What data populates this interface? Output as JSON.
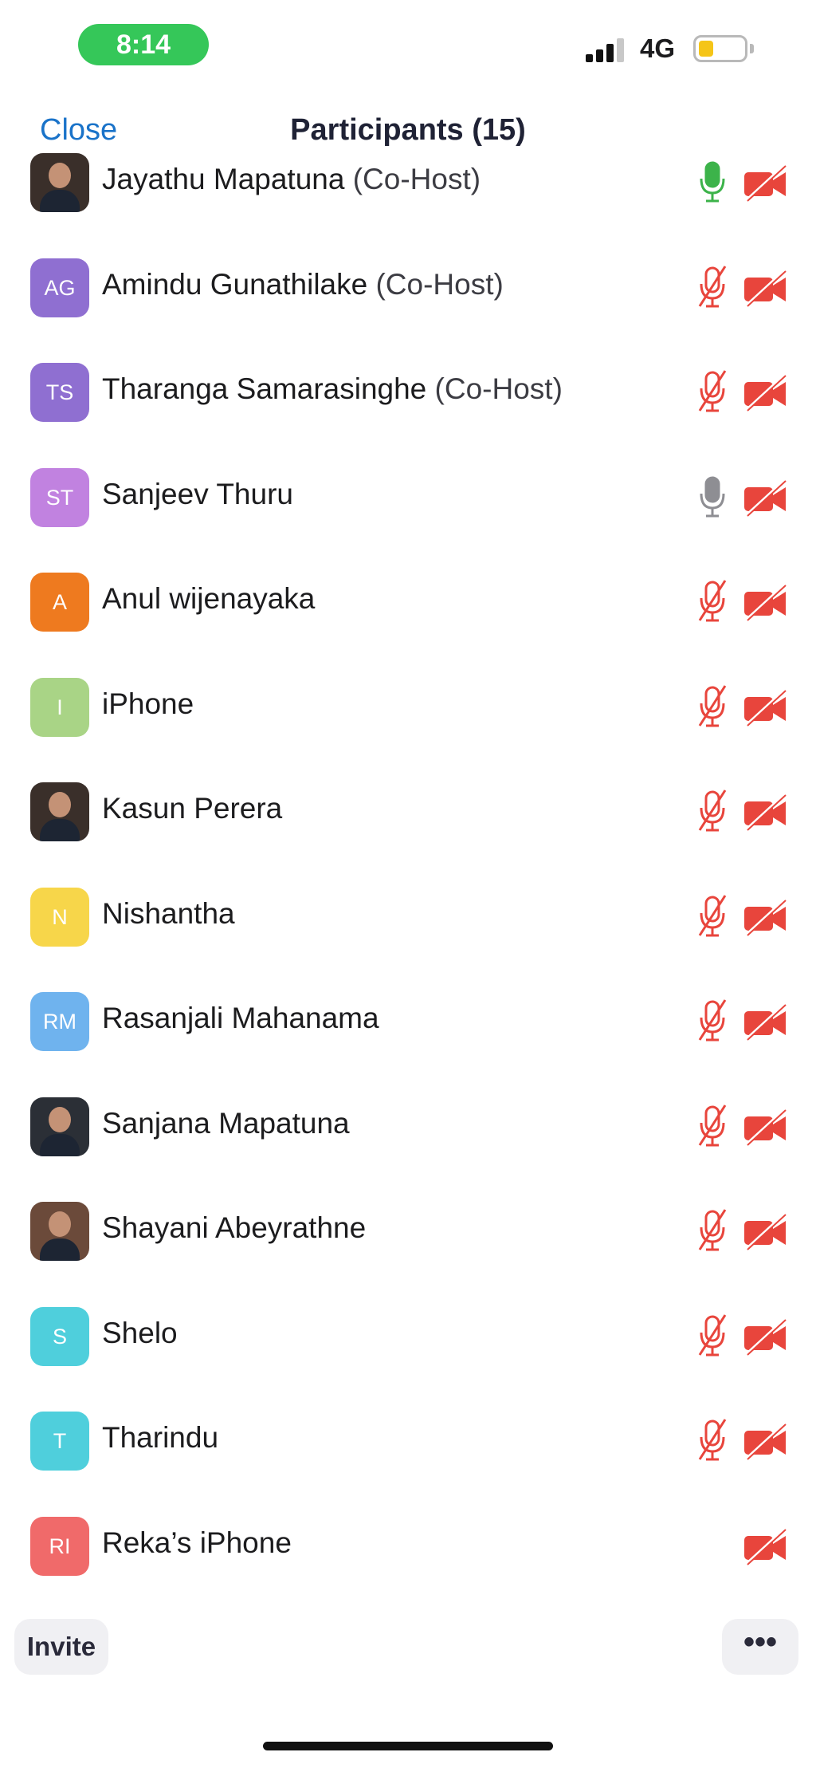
{
  "status_bar": {
    "time": "8:14",
    "network": "4G"
  },
  "nav": {
    "close_label": "Close",
    "title": "Participants (15)"
  },
  "participants": [
    {
      "name": "Jayathu Mapatuna",
      "role": "(Co-Host)",
      "avatar_type": "photo",
      "initials": "",
      "avatar_color": "#3a2f2a",
      "mic": "on"
    },
    {
      "name": "Amindu Gunathilake",
      "role": "(Co-Host)",
      "avatar_type": "initials",
      "initials": "AG",
      "avatar_color": "#8f6fd1",
      "mic": "muted"
    },
    {
      "name": "Tharanga Samarasinghe",
      "role": "(Co-Host)",
      "avatar_type": "initials",
      "initials": "TS",
      "avatar_color": "#8f6fd1",
      "mic": "muted"
    },
    {
      "name": "Sanjeev Thuru",
      "role": "",
      "avatar_type": "initials",
      "initials": "ST",
      "avatar_color": "#c182e0",
      "mic": "idle"
    },
    {
      "name": "Anul wijenayaka",
      "role": "",
      "avatar_type": "initials",
      "initials": "A",
      "avatar_color": "#ee7a1f",
      "mic": "muted"
    },
    {
      "name": "iPhone",
      "role": "",
      "avatar_type": "initials",
      "initials": "I",
      "avatar_color": "#a9d486",
      "mic": "muted"
    },
    {
      "name": "Kasun Perera",
      "role": "",
      "avatar_type": "photo",
      "initials": "",
      "avatar_color": "#3a2f2a",
      "mic": "muted"
    },
    {
      "name": "Nishantha",
      "role": "",
      "avatar_type": "initials",
      "initials": "N",
      "avatar_color": "#f7d64a",
      "mic": "muted"
    },
    {
      "name": "Rasanjali Mahanama",
      "role": "",
      "avatar_type": "initials",
      "initials": "RM",
      "avatar_color": "#6fb3ee",
      "mic": "muted"
    },
    {
      "name": "Sanjana Mapatuna",
      "role": "",
      "avatar_type": "photo",
      "initials": "",
      "avatar_color": "#2b2f36",
      "mic": "muted"
    },
    {
      "name": "Shayani Abeyrathne",
      "role": "",
      "avatar_type": "photo",
      "initials": "",
      "avatar_color": "#6b4a3a",
      "mic": "muted"
    },
    {
      "name": "Shelo",
      "role": "",
      "avatar_type": "initials",
      "initials": "S",
      "avatar_color": "#4fcfdc",
      "mic": "muted"
    },
    {
      "name": "Tharindu",
      "role": "",
      "avatar_type": "initials",
      "initials": "T",
      "avatar_color": "#4fcfdc",
      "mic": "muted"
    },
    {
      "name": "Reka’s iPhone",
      "role": "",
      "avatar_type": "initials",
      "initials": "RI",
      "avatar_color": "#f06a6a",
      "mic": "none"
    }
  ],
  "footer": {
    "invite_label": "Invite",
    "more_label": "•••"
  },
  "colors": {
    "accent": "#1a73c9",
    "muted_red": "#e8453c",
    "mic_on_green": "#3cb34a",
    "mic_idle_gray": "#8e8e93"
  },
  "icons": {
    "mic": "microphone-icon",
    "mic_muted": "mic-muted-icon",
    "camera_off": "video-off-icon"
  }
}
